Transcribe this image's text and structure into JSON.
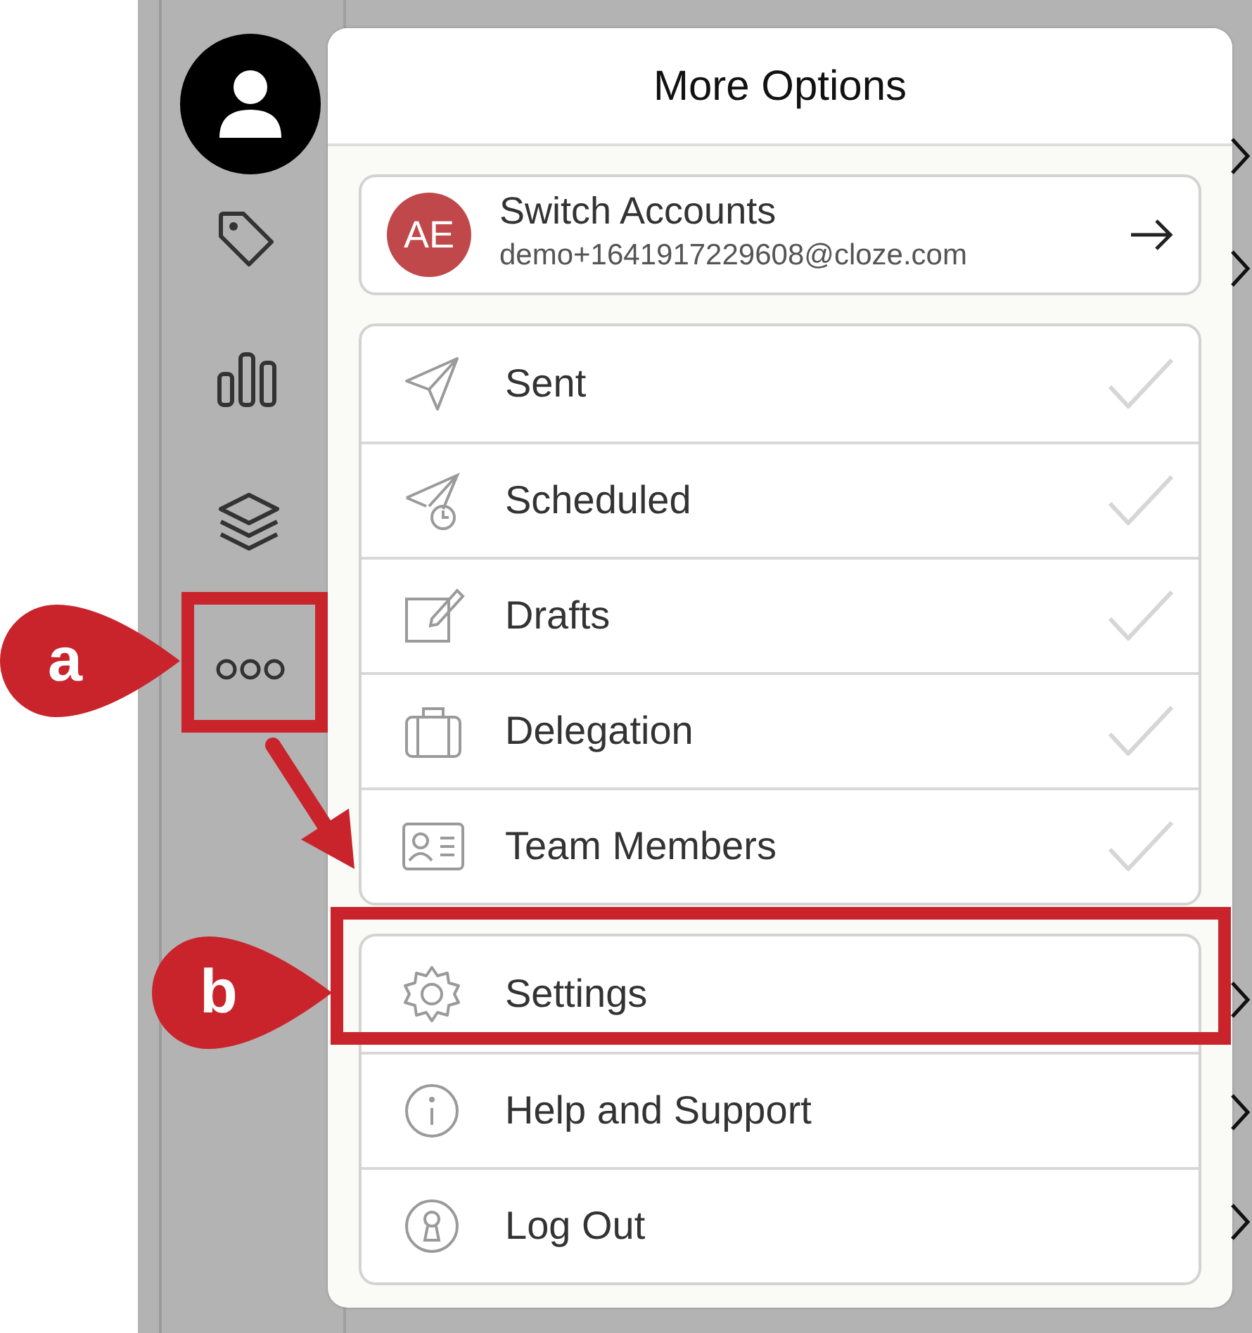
{
  "menu": {
    "title": "More Options",
    "account": {
      "initials": "AE",
      "name": "Switch Accounts",
      "email": "demo+1641917229608@cloze.com"
    },
    "items": [
      {
        "label": "Sent"
      },
      {
        "label": "Scheduled"
      },
      {
        "label": "Drafts"
      },
      {
        "label": "Delegation"
      },
      {
        "label": "Team Members"
      }
    ],
    "footer_items": [
      {
        "label": "Settings"
      },
      {
        "label": "Help and Support"
      },
      {
        "label": "Log Out"
      }
    ]
  },
  "annotations": [
    {
      "label": "a"
    },
    {
      "label": "b"
    }
  ]
}
